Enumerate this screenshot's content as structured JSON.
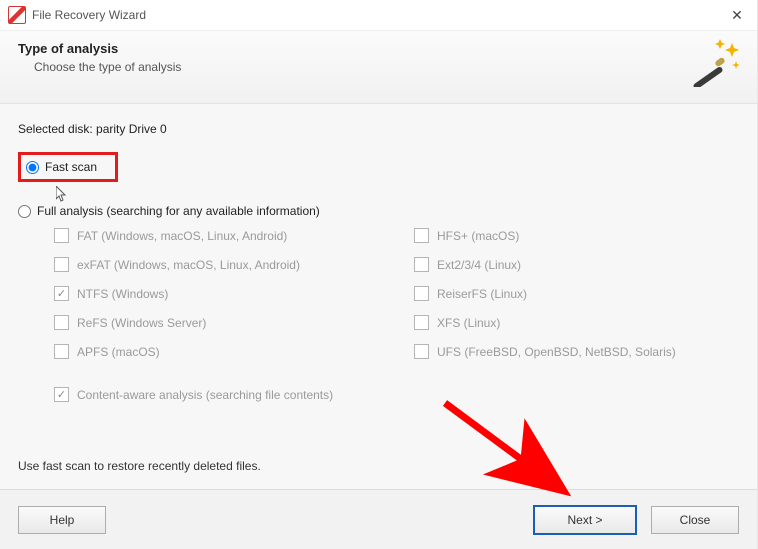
{
  "titlebar": {
    "title": "File Recovery Wizard"
  },
  "header": {
    "title": "Type of analysis",
    "subtitle": "Choose the type of analysis"
  },
  "body": {
    "selected_disk_label": "Selected disk: parity Drive 0",
    "fast_scan_label": "Fast scan",
    "full_analysis_label": "Full analysis (searching for any available information)",
    "fs": {
      "fat": "FAT (Windows, macOS, Linux, Android)",
      "exfat": "exFAT (Windows, macOS, Linux, Android)",
      "ntfs": "NTFS (Windows)",
      "refs": "ReFS (Windows Server)",
      "apfs": "APFS (macOS)",
      "hfs": "HFS+ (macOS)",
      "ext": "Ext2/3/4 (Linux)",
      "reiser": "ReiserFS (Linux)",
      "xfs": "XFS (Linux)",
      "ufs": "UFS (FreeBSD, OpenBSD, NetBSD, Solaris)"
    },
    "content_aware_label": "Content-aware analysis (searching file contents)",
    "hint": "Use fast scan to restore recently deleted files."
  },
  "footer": {
    "help": "Help",
    "next": "Next >",
    "close": "Close"
  },
  "state": {
    "selected_mode": "fast",
    "ntfs_checked": true,
    "content_aware_checked": true
  },
  "annotations": {
    "highlight_fast_scan": true,
    "arrow_to_next": true
  }
}
